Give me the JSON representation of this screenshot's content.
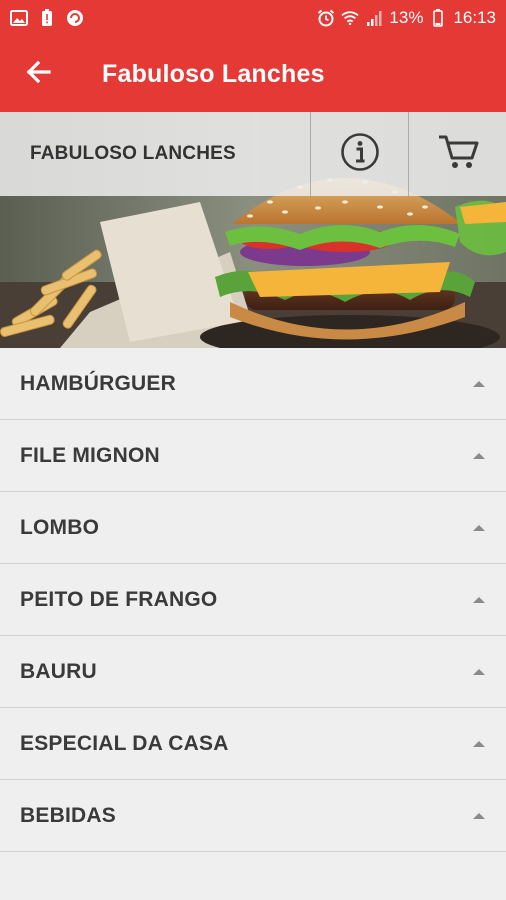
{
  "status_bar": {
    "battery": "13%",
    "time": "16:13",
    "icons": [
      "image-icon",
      "alert-battery-icon",
      "app-notification-icon",
      "alarm-icon",
      "wifi-icon",
      "signal-icon",
      "battery-icon"
    ]
  },
  "app_bar": {
    "title": "Fabuloso Lanches",
    "back_icon": "arrow-back-icon"
  },
  "store_header": {
    "name": "FABULOSO LANCHES",
    "info_icon": "info-icon",
    "cart_icon": "cart-icon"
  },
  "categories": [
    {
      "label": "HAMBÚRGUER"
    },
    {
      "label": "FILE MIGNON"
    },
    {
      "label": "LOMBO"
    },
    {
      "label": "PEITO DE FRANGO"
    },
    {
      "label": "BAURU"
    },
    {
      "label": "ESPECIAL DA CASA"
    },
    {
      "label": "BEBIDAS"
    }
  ],
  "colors": {
    "primary": "#e53935",
    "background": "#efefef",
    "text": "#3a3a3a"
  }
}
